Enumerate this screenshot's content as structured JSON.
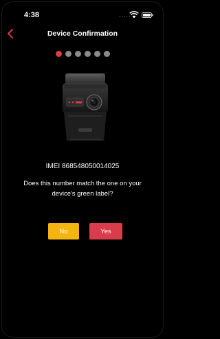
{
  "status_bar": {
    "time": "4:38",
    "carrier": "....."
  },
  "nav": {
    "title": "Device Confirmation"
  },
  "progress": {
    "total_steps": 6,
    "current_step": 1
  },
  "device": {
    "imei_text": "IMEI 868548050014025"
  },
  "prompt": {
    "question": "Does this number match the one on your device's green label?"
  },
  "actions": {
    "no_label": "No",
    "yes_label": "Yes"
  },
  "colors": {
    "accent": "#d93c4a",
    "no_button": "#f5b511",
    "inactive_dot": "#8b8b8b",
    "background": "#000000"
  }
}
